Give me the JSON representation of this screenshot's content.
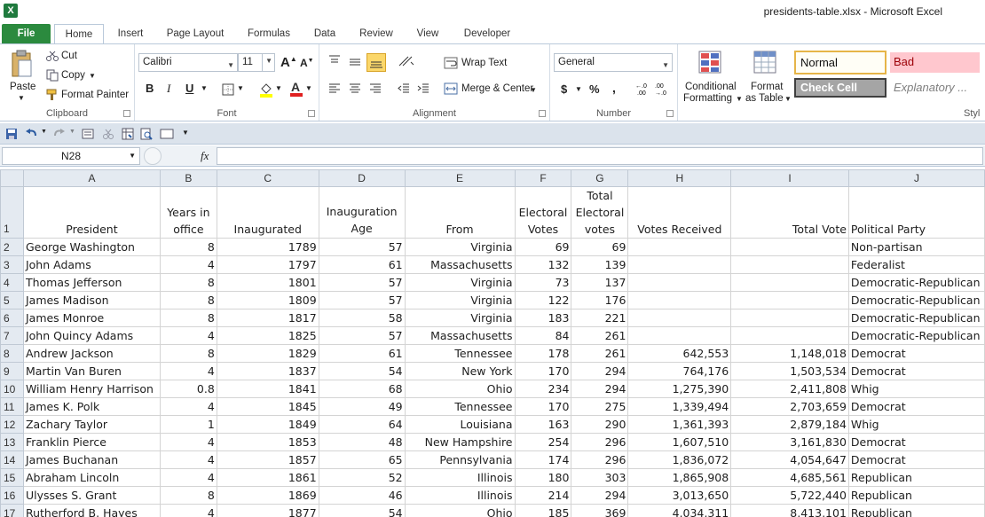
{
  "window": {
    "title": "presidents-table.xlsx  -  Microsoft Excel",
    "app_icon": "excel-icon"
  },
  "tabs": [
    "File",
    "Home",
    "Insert",
    "Page Layout",
    "Formulas",
    "Data",
    "Review",
    "View",
    "Developer"
  ],
  "clipboard": {
    "paste": "Paste",
    "cut": "Cut",
    "copy": "Copy",
    "format_painter": "Format Painter",
    "label": "Clipboard"
  },
  "font": {
    "name": "Calibri",
    "size": "11",
    "bold": "B",
    "italic": "I",
    "underline": "U",
    "label": "Font"
  },
  "alignment": {
    "wrap_text": "Wrap Text",
    "merge_center": "Merge & Center",
    "label": "Alignment"
  },
  "number": {
    "format": "General",
    "currency": "$",
    "percent": "%",
    "comma": ",",
    "label": "Number"
  },
  "styles": {
    "conditional": "Conditional",
    "formatting": "Formatting",
    "format": "Format",
    "as_table": "as Table",
    "normal": "Normal",
    "bad": "Bad",
    "check_cell": "Check Cell",
    "explanatory": "Explanatory ...",
    "label": "Styl"
  },
  "formula_bar": {
    "name_box": "N28",
    "fx": "fx",
    "content": ""
  },
  "columns": [
    "A",
    "B",
    "C",
    "D",
    "E",
    "F",
    "G",
    "H",
    "I",
    "J"
  ],
  "headers": {
    "A": "President",
    "B": "Years in office",
    "C": "Inaugurated",
    "D": "Inauguration Age",
    "E": "From",
    "F": "Electoral Votes",
    "G": "Total Electoral votes",
    "H": "Votes Received",
    "I": "Total Vote",
    "J": "Political Party"
  },
  "rows": [
    {
      "n": "2",
      "A": "George Washington",
      "B": "8",
      "C": "1789",
      "D": "57",
      "E": "Virginia",
      "F": "69",
      "G": "69",
      "H": "",
      "I": "",
      "J": "Non-partisan"
    },
    {
      "n": "3",
      "A": "John Adams",
      "B": "4",
      "C": "1797",
      "D": "61",
      "E": "Massachusetts",
      "F": "132",
      "G": "139",
      "H": "",
      "I": "",
      "J": "Federalist"
    },
    {
      "n": "4",
      "A": "Thomas Jefferson",
      "B": "8",
      "C": "1801",
      "D": "57",
      "E": "Virginia",
      "F": "73",
      "G": "137",
      "H": "",
      "I": "",
      "J": "Democratic-Republican"
    },
    {
      "n": "5",
      "A": "James Madison",
      "B": "8",
      "C": "1809",
      "D": "57",
      "E": "Virginia",
      "F": "122",
      "G": "176",
      "H": "",
      "I": "",
      "J": "Democratic-Republican"
    },
    {
      "n": "6",
      "A": "James Monroe",
      "B": "8",
      "C": "1817",
      "D": "58",
      "E": "Virginia",
      "F": "183",
      "G": "221",
      "H": "",
      "I": "",
      "J": "Democratic-Republican"
    },
    {
      "n": "7",
      "A": "John Quincy Adams",
      "B": "4",
      "C": "1825",
      "D": "57",
      "E": "Massachusetts",
      "F": "84",
      "G": "261",
      "H": "",
      "I": "",
      "J": "Democratic-Republican"
    },
    {
      "n": "8",
      "A": "Andrew Jackson",
      "B": "8",
      "C": "1829",
      "D": "61",
      "E": "Tennessee",
      "F": "178",
      "G": "261",
      "H": "642,553",
      "I": "1,148,018",
      "J": "Democrat"
    },
    {
      "n": "9",
      "A": "Martin Van Buren",
      "B": "4",
      "C": "1837",
      "D": "54",
      "E": "New York",
      "F": "170",
      "G": "294",
      "H": "764,176",
      "I": "1,503,534",
      "J": "Democrat"
    },
    {
      "n": "10",
      "A": "William Henry Harrison",
      "B": "0.8",
      "C": "1841",
      "D": "68",
      "E": "Ohio",
      "F": "234",
      "G": "294",
      "H": "1,275,390",
      "I": "2,411,808",
      "J": "Whig"
    },
    {
      "n": "11",
      "A": "James K. Polk",
      "B": "4",
      "C": "1845",
      "D": "49",
      "E": "Tennessee",
      "F": "170",
      "G": "275",
      "H": "1,339,494",
      "I": "2,703,659",
      "J": "Democrat"
    },
    {
      "n": "12",
      "A": "Zachary Taylor",
      "B": "1",
      "C": "1849",
      "D": "64",
      "E": "Louisiana",
      "F": "163",
      "G": "290",
      "H": "1,361,393",
      "I": "2,879,184",
      "J": "Whig"
    },
    {
      "n": "13",
      "A": "Franklin Pierce",
      "B": "4",
      "C": "1853",
      "D": "48",
      "E": "New Hampshire",
      "F": "254",
      "G": "296",
      "H": "1,607,510",
      "I": "3,161,830",
      "J": "Democrat"
    },
    {
      "n": "14",
      "A": "James Buchanan",
      "B": "4",
      "C": "1857",
      "D": "65",
      "E": "Pennsylvania",
      "F": "174",
      "G": "296",
      "H": "1,836,072",
      "I": "4,054,647",
      "J": "Democrat"
    },
    {
      "n": "15",
      "A": "Abraham Lincoln",
      "B": "4",
      "C": "1861",
      "D": "52",
      "E": "Illinois",
      "F": "180",
      "G": "303",
      "H": "1,865,908",
      "I": "4,685,561",
      "J": "Republican"
    },
    {
      "n": "16",
      "A": "Ulysses S. Grant",
      "B": "8",
      "C": "1869",
      "D": "46",
      "E": "Illinois",
      "F": "214",
      "G": "294",
      "H": "3,013,650",
      "I": "5,722,440",
      "J": "Republican"
    },
    {
      "n": "17",
      "A": "Rutherford B. Hayes",
      "B": "4",
      "C": "1877",
      "D": "54",
      "E": "Ohio",
      "F": "185",
      "G": "369",
      "H": "4,034,311",
      "I": "8,413,101",
      "J": "Republican"
    }
  ]
}
